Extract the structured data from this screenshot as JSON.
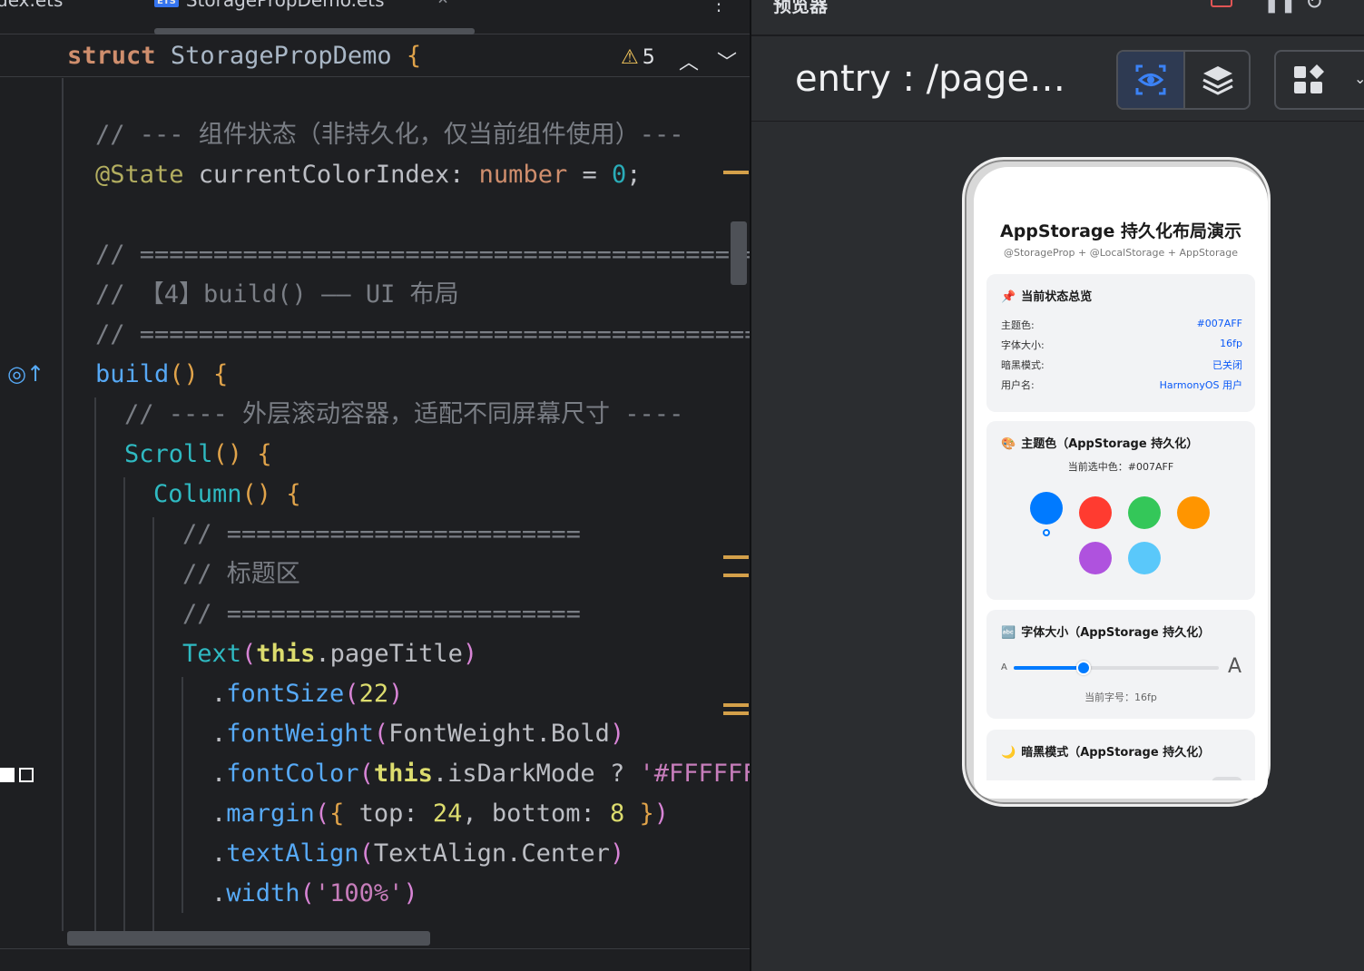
{
  "editor": {
    "tabs": [
      {
        "label": "dex.ets"
      },
      {
        "label": "StoragePropDemo.ets",
        "badge": "ETS"
      }
    ],
    "tab_close": "×",
    "tab_more": "⋮",
    "sticky": {
      "keyword": "struct",
      "name": "StoragePropDemo",
      "brace": "{"
    },
    "warnings": {
      "count": "5"
    },
    "lines": {
      "l1_comment": "// --- 组件状态（非持久化，仅当前组件使用）---",
      "l2_decorator": "@State",
      "l2_name": " currentColorIndex",
      "l2_colon": ": ",
      "l2_type": "number",
      "l2_eq": " = ",
      "l2_val": "0",
      "l2_semi": ";",
      "l3_comment": "// ============================================",
      "l4_comment": "// 【4】build() —— UI 布局",
      "l5_comment": "// ============================================",
      "l6_fn": "build",
      "l6_rest": "() {",
      "l7_comment": "// ---- 外层滚动容器，适配不同屏幕尺寸 ----",
      "l8_fn": "Scroll",
      "l8_rest": "() {",
      "l9_fn": "Column",
      "l9_rest": "() {",
      "l10_comment": "// ========================",
      "l11_comment": "// 标题区",
      "l12_comment": "// ========================",
      "l13_fn": "Text",
      "l13_open": "(",
      "l13_this": "this",
      "l13_rest": ".pageTitle",
      "l13_close": ")",
      "l14_dot": ".",
      "l14_m": "fontSize",
      "l14_open": "(",
      "l14_num": "22",
      "l14_close": ")",
      "l15_dot": ".",
      "l15_m": "fontWeight",
      "l15_open": "(",
      "l15_arg": "FontWeight.Bold",
      "l15_close": ")",
      "l16_dot": ".",
      "l16_m": "fontColor",
      "l16_open": "(",
      "l16_this": "this",
      "l16_rest": ".isDarkMode ? ",
      "l16_str": "'#FFFFFF",
      "l17_dot": ".",
      "l17_m": "margin",
      "l17_open": "(",
      "l17_brace": "{",
      "l17_k1": " top",
      "l17_c1": ": ",
      "l17_n1": "24",
      "l17_comma": ", ",
      "l17_k2": "bottom",
      "l17_c2": ": ",
      "l17_n2": "8",
      "l17_end": " }",
      "l17_close": ")",
      "l18_dot": ".",
      "l18_m": "textAlign",
      "l18_open": "(",
      "l18_arg": "TextAlign.Center",
      "l18_close": ")",
      "l19_dot": ".",
      "l19_m": "width",
      "l19_open": "(",
      "l19_str": "'100%'",
      "l19_close": ")"
    }
  },
  "preview": {
    "title": "预览器",
    "route": "entry : /page…",
    "toolbar_icons": [
      "inspect-eye-icon",
      "layers-icon",
      "component-grid-icon"
    ]
  },
  "app": {
    "title": "AppStorage 持久化布局演示",
    "subtitle": "@StorageProp + @LocalStorage + AppStorage",
    "status_card": {
      "icon": "📌",
      "title": "当前状态总览",
      "rows": [
        {
          "key": "主题色:",
          "value": "#007AFF"
        },
        {
          "key": "字体大小:",
          "value": "16fp"
        },
        {
          "key": "暗黑模式:",
          "value": "已关闭"
        },
        {
          "key": "用户名:",
          "value": "HarmonyOS 用户"
        }
      ]
    },
    "color_card": {
      "icon": "🎨",
      "title": "主题色（AppStorage 持久化）",
      "current": "当前选中色：#007AFF",
      "swatches": [
        "#007AFF",
        "#FF3B30",
        "#34C759",
        "#FF9500",
        "#AF52DE",
        "#5AC8FA"
      ],
      "selected_index": 0
    },
    "font_card": {
      "icon": "🔤",
      "title": "字体大小（AppStorage 持久化）",
      "small_a": "A",
      "large_a": "A",
      "slider_fraction": 0.34,
      "current": "当前字号：16fp"
    },
    "dark_card": {
      "icon": "🌙",
      "title": "暗黑模式（AppStorage 持久化）"
    }
  },
  "colors": {
    "accent": "#007AFF",
    "editor_bg": "#1E1F22",
    "preview_bg": "#2B2D30"
  }
}
